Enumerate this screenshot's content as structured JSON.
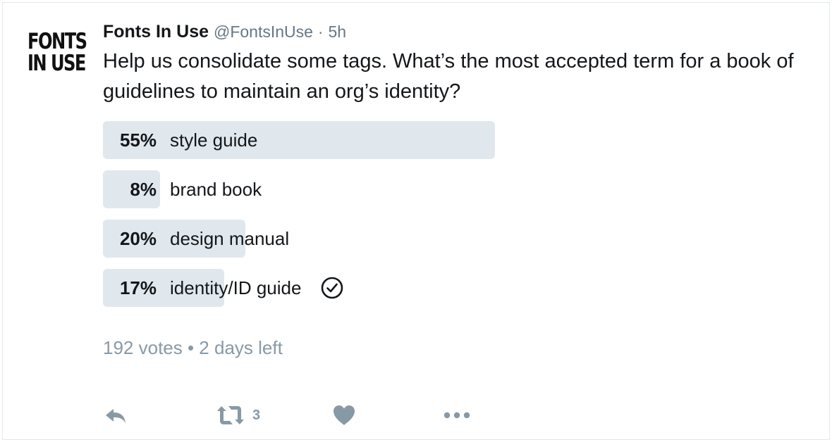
{
  "tweet": {
    "avatar_text_line1": "FONTS",
    "avatar_text_line2": "IN USE",
    "author_name": "Fonts In Use",
    "author_handle": "@FontsInUse",
    "separator": "·",
    "time": "5h",
    "text": "Help us consolidate some tags. What’s the most accepted term for a book of guidelines to maintain an org’s identity?"
  },
  "poll": {
    "options": [
      {
        "percent_label": "55%",
        "label": "style guide",
        "percent": 55,
        "selected": false
      },
      {
        "percent_label": "8%",
        "label": "brand book",
        "percent": 8,
        "selected": false
      },
      {
        "percent_label": "20%",
        "label": "design manual",
        "percent": 20,
        "selected": false
      },
      {
        "percent_label": "17%",
        "label": "identity/ID guide",
        "percent": 17,
        "selected": true
      }
    ],
    "meta": "192 votes • 2 days left"
  },
  "actions": {
    "reply_icon": "reply-icon",
    "retweet_icon": "retweet-icon",
    "retweet_count": "3",
    "like_icon": "heart-icon",
    "more_icon": "more-icon"
  },
  "colors": {
    "bar": "#e1e8ed",
    "muted": "#8899a6",
    "text": "#14171a"
  }
}
